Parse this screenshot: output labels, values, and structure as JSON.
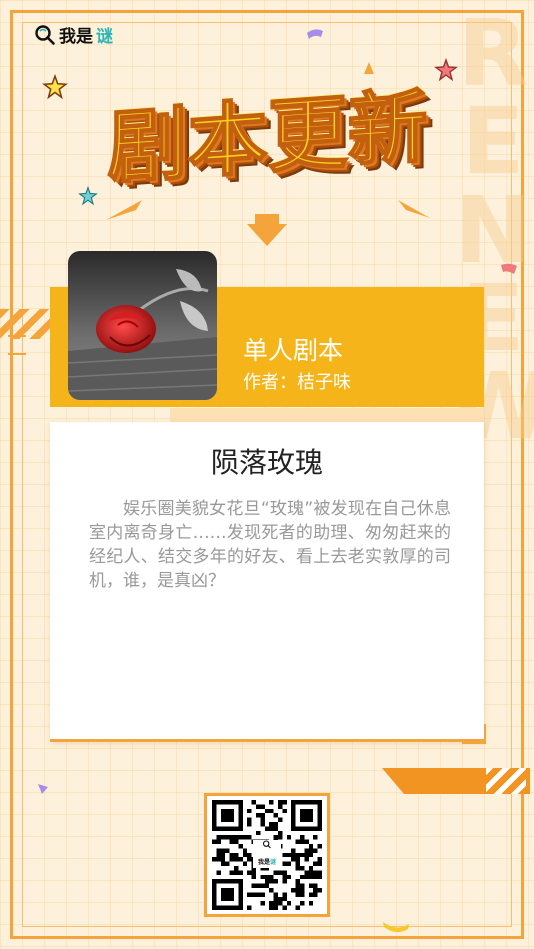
{
  "brand": {
    "text_dark": "我是",
    "text_accent": "谜",
    "icon": "search-icon"
  },
  "headline": {
    "text": "剧本更新"
  },
  "watermark": {
    "text": "RENEW"
  },
  "script": {
    "type": "单人剧本",
    "author_label": "作者：",
    "author_name": "桔子味",
    "title": "陨落玫瑰",
    "synopsis": "娱乐圈美貌女花旦“玫瑰”被发现在自己休息室内离奇身亡……发现死者的助理、匆匆赶来的经纪人、结交多年的好友、看上去老实敦厚的司机，谁，是真凶？"
  },
  "qr": {
    "logo_text_dark": "我是",
    "logo_text_accent": "谜"
  },
  "colors": {
    "orange": "#f4a43a",
    "yellow": "#f5b51a",
    "accent_teal": "#2bb5b8",
    "background": "#fdf1dc"
  }
}
